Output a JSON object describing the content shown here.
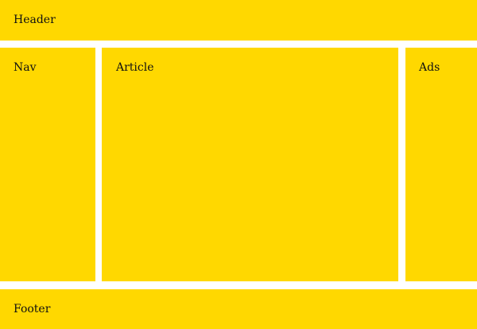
{
  "layout": {
    "header": {
      "label": "Header"
    },
    "nav": {
      "label": "Nav"
    },
    "article": {
      "label": "Article"
    },
    "ads": {
      "label": "Ads"
    },
    "footer": {
      "label": "Footer"
    }
  },
  "colors": {
    "panel_background": "#ffd800",
    "gutter": "#ffffff",
    "text": "#111111"
  }
}
